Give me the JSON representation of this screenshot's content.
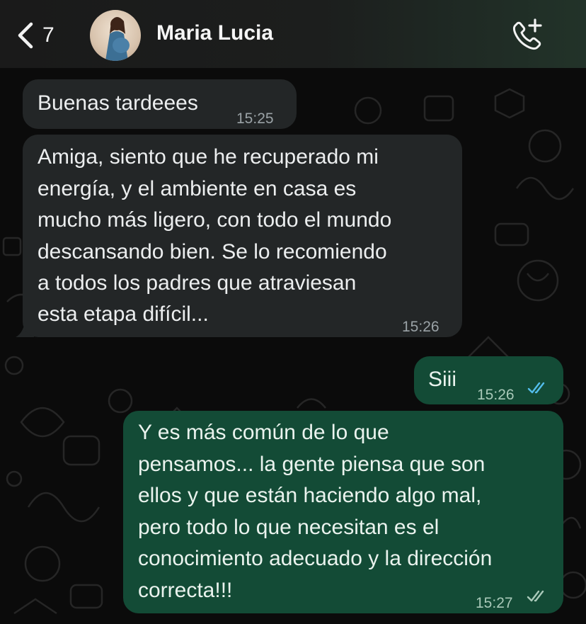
{
  "header": {
    "back_count": "7",
    "contact_name": "Maria Lucia"
  },
  "icons": {
    "back": "chevron-left-icon",
    "call": "phone-plus-icon",
    "read_receipt": "double-check-icon"
  },
  "colors": {
    "incoming_bubble": "#232627",
    "outgoing_bubble": "#134b36",
    "read_ticks_blue": "#53bdeb",
    "delivered_ticks_gray": "#a9c9b9"
  },
  "messages": [
    {
      "direction": "incoming",
      "lines": [
        "Buenas tardeees"
      ],
      "time": "15:25"
    },
    {
      "direction": "incoming",
      "lines": [
        "Amiga, siento que he recuperado mi",
        "energía, y el ambiente en casa es",
        "mucho más ligero, con todo el mundo",
        "descansando bien. Se lo recomiendo",
        "a todos los padres que atraviesan",
        "esta etapa difícil..."
      ],
      "time": "15:26"
    },
    {
      "direction": "outgoing",
      "lines": [
        "Siii"
      ],
      "time": "15:26",
      "status": "read"
    },
    {
      "direction": "outgoing",
      "lines": [
        "Y es más común de lo que",
        "pensamos... la gente piensa que son",
        "ellos y que están haciendo algo mal,",
        "pero todo lo que necesitan es el",
        "conocimiento adecuado y la dirección",
        "correcta!!!"
      ],
      "time": "15:27",
      "status": "delivered"
    }
  ]
}
